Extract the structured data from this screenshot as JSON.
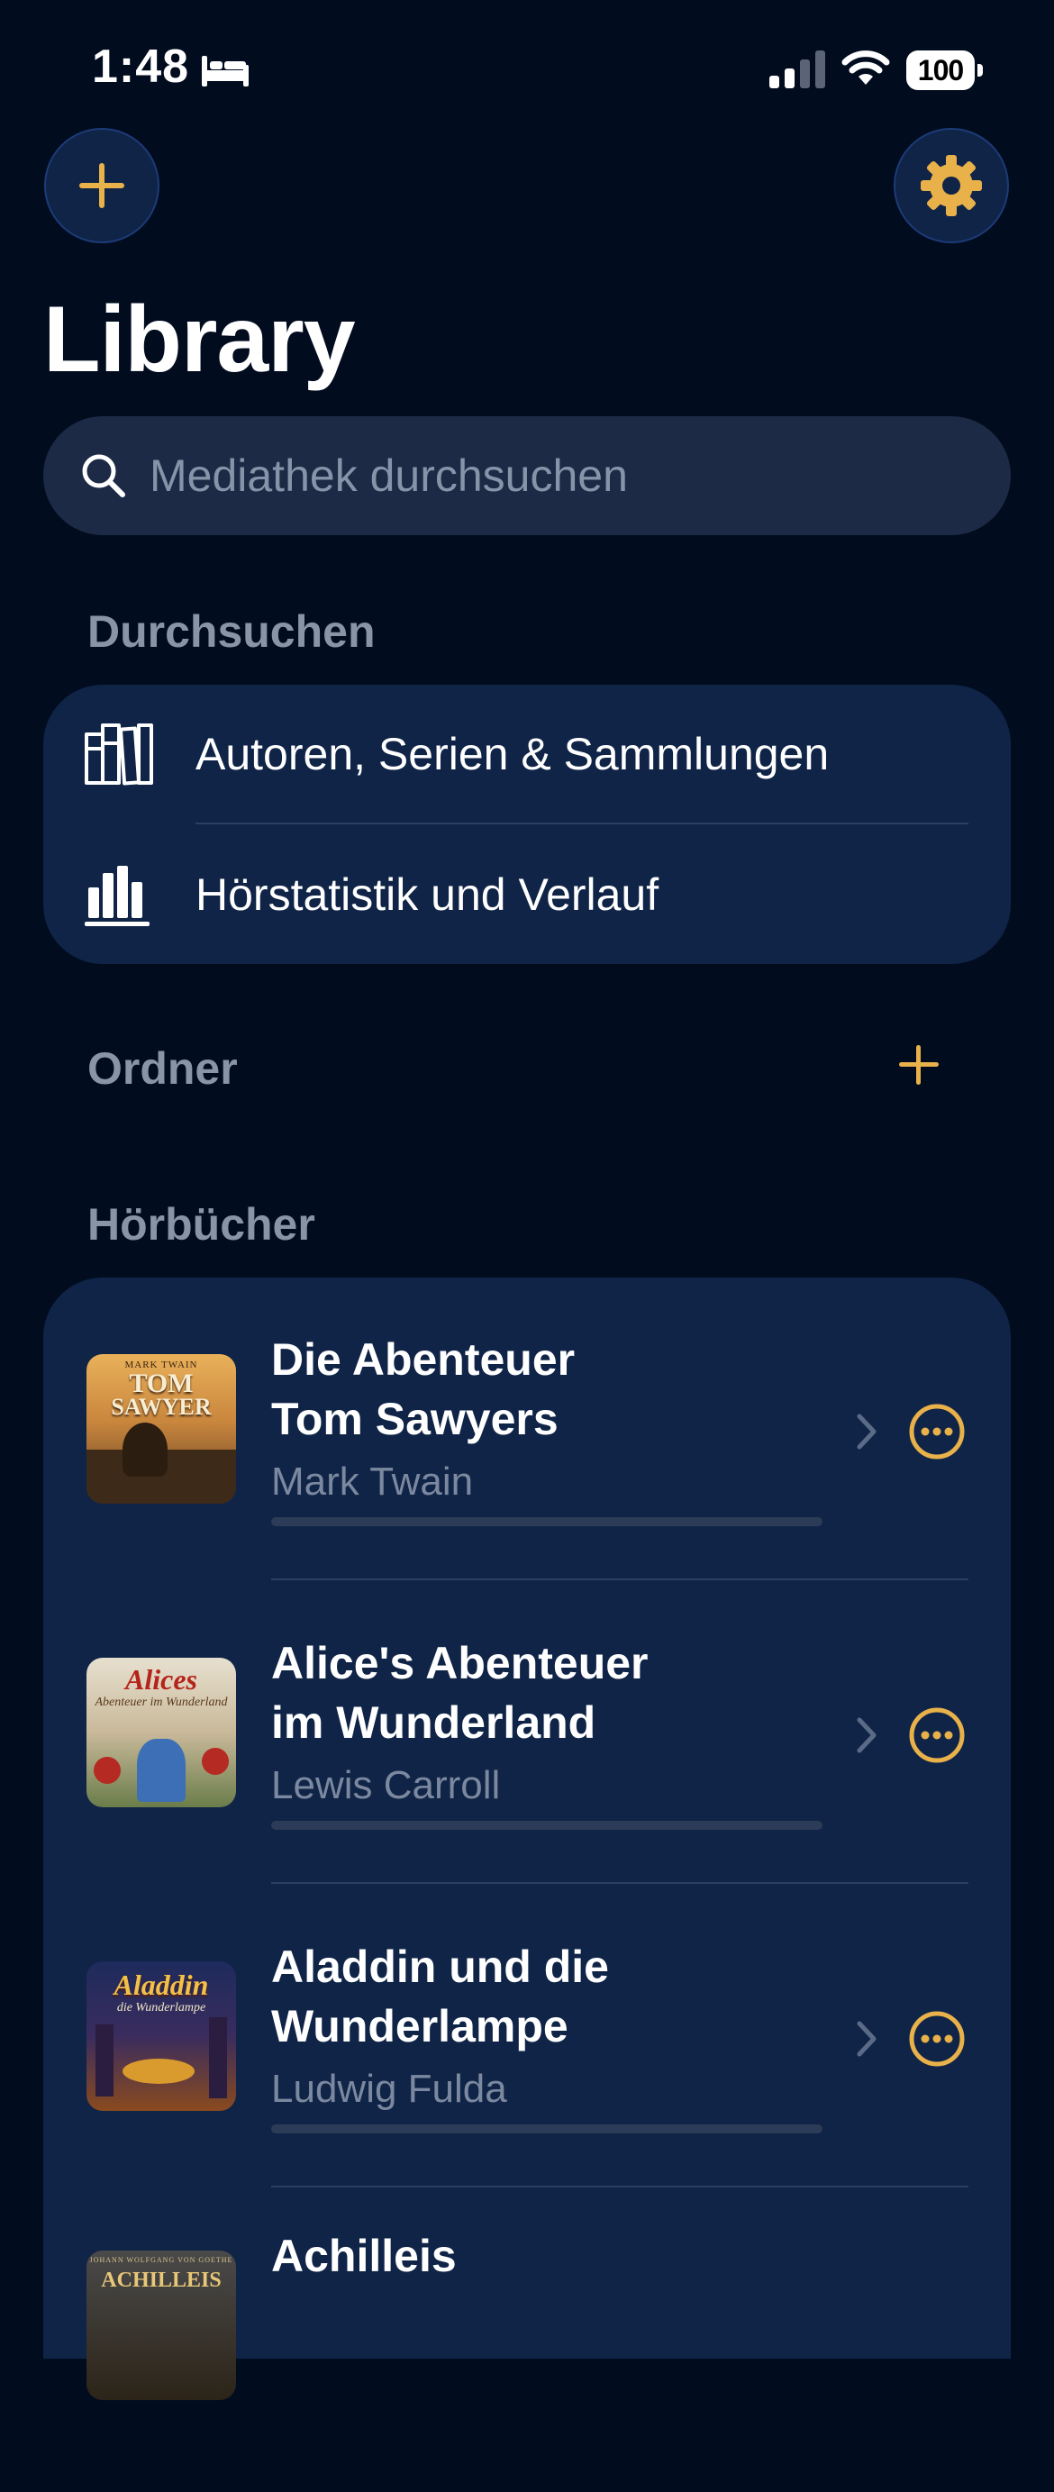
{
  "status_bar": {
    "time": "1:48",
    "battery": "100"
  },
  "header": {
    "title": "Library",
    "add_icon": "plus-icon",
    "settings_icon": "gear-icon"
  },
  "search": {
    "placeholder": "Mediathek durchsuchen"
  },
  "browse": {
    "section_title": "Durchsuchen",
    "items": [
      {
        "label": "Autoren, Serien & Sammlungen",
        "icon": "bookshelf-icon"
      },
      {
        "label": "Hörstatistik und Verlauf",
        "icon": "bar-chart-icon"
      }
    ]
  },
  "folders": {
    "section_title": "Ordner"
  },
  "audiobooks": {
    "section_title": "Hörbücher",
    "items": [
      {
        "title_line1": "Die Abenteuer",
        "title_line2": "Tom Sawyers",
        "author": "Mark Twain",
        "cover_top": "MARK TWAIN",
        "cover_title_1": "TOM",
        "cover_title_2": "SAWYER",
        "cover_sub": "",
        "progress": 0
      },
      {
        "title_line1": "Alice's Abenteuer",
        "title_line2": "im Wunderland",
        "author": "Lewis Carroll",
        "cover_top": "",
        "cover_title_1": "Alices",
        "cover_title_2": "",
        "cover_sub": "Abenteuer im Wunderland",
        "progress": 0
      },
      {
        "title_line1": "Aladdin und die",
        "title_line2": "Wunderlampe",
        "author": "Ludwig Fulda",
        "cover_top": "",
        "cover_title_1": "Aladdin",
        "cover_title_2": "",
        "cover_sub": "die Wunderlampe",
        "progress": 0
      },
      {
        "title_line1": "Achilleis",
        "title_line2": "",
        "author": "",
        "cover_top": "JOHANN WOLFGANG VON GOETHE",
        "cover_title_1": "ACHILLEIS",
        "cover_title_2": "",
        "cover_sub": "",
        "progress": 0
      }
    ]
  },
  "colors": {
    "background": "#020c1f",
    "card": "#0f2447",
    "accent": "#e8b14a",
    "secondary_text": "#8a94a8"
  }
}
